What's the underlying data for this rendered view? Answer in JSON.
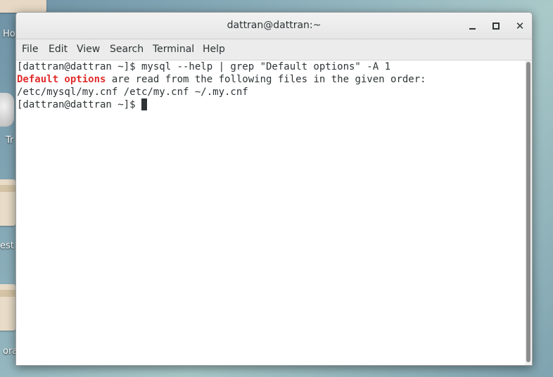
{
  "desktop": {
    "icons": [
      {
        "label": "Ho"
      },
      {
        "label": "Tr"
      },
      {
        "label": "est"
      },
      {
        "label": "ora"
      }
    ]
  },
  "window": {
    "title": "dattran@dattran:~",
    "buttons": {
      "minimize": "minimize",
      "maximize": "maximize",
      "close": "✕"
    }
  },
  "menu": {
    "items": [
      "File",
      "Edit",
      "View",
      "Search",
      "Terminal",
      "Help"
    ]
  },
  "terminal": {
    "line1": "[dattran@dattran ~]$ mysql --help | grep \"Default options\" -A 1",
    "line2_highlight": "Default options",
    "line2_rest": " are read from the following files in the given order:",
    "line3": "/etc/mysql/my.cnf /etc/my.cnf ~/.my.cnf",
    "line4_prompt": "[dattran@dattran ~]$ ",
    "highlight_color": "#e02e2e"
  }
}
